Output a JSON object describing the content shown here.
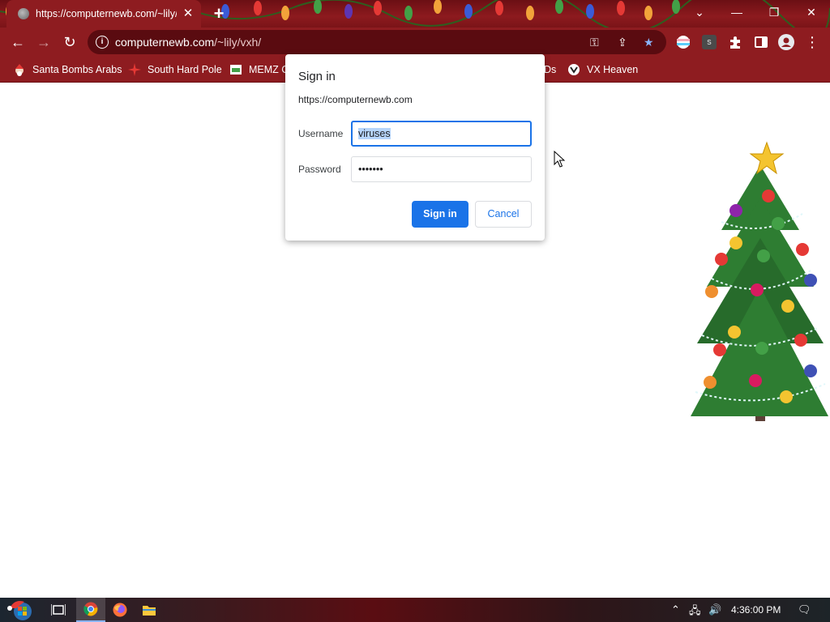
{
  "browser": {
    "tab": {
      "title": "https://computernewb.com/~lily/vxh/",
      "close_glyph": "✕"
    },
    "new_tab_glyph": "+",
    "window_controls": {
      "tab_search": "⌄",
      "minimize": "—",
      "restore": "❐",
      "close": "✕"
    },
    "nav": {
      "back": "←",
      "forward": "→",
      "reload": "↻"
    },
    "omnibox": {
      "host": "computernewb.com",
      "path": "/~lily/vxh/",
      "info_glyph": "i"
    },
    "toolbar_glyphs": {
      "key": "⚿",
      "share": "⇪",
      "bookmark_star": "★",
      "menu": "⋮",
      "extension_s": "s"
    },
    "bookmarks": [
      {
        "label": "Santa Bombs Arabs"
      },
      {
        "label": "South Hard Pole"
      },
      {
        "label": "MEMZ C"
      },
      {
        "label": "Ds"
      },
      {
        "label": "VX Heaven"
      }
    ]
  },
  "dialog": {
    "title": "Sign in",
    "origin": "https://computernewb.com",
    "username_label": "Username",
    "username_value": "viruses",
    "password_label": "Password",
    "password_value": "•••••••",
    "sign_in_label": "Sign in",
    "cancel_label": "Cancel"
  },
  "taskbar": {
    "clock": "4:36:00 PM",
    "tray_glyphs": {
      "chevron": "⌃",
      "network": "🖧",
      "volume": "🔊",
      "notifications": "🗨"
    }
  },
  "colors": {
    "chrome_red": "#8e1c20",
    "accent_blue": "#1a73e8",
    "selection": "#b6d5fb"
  }
}
